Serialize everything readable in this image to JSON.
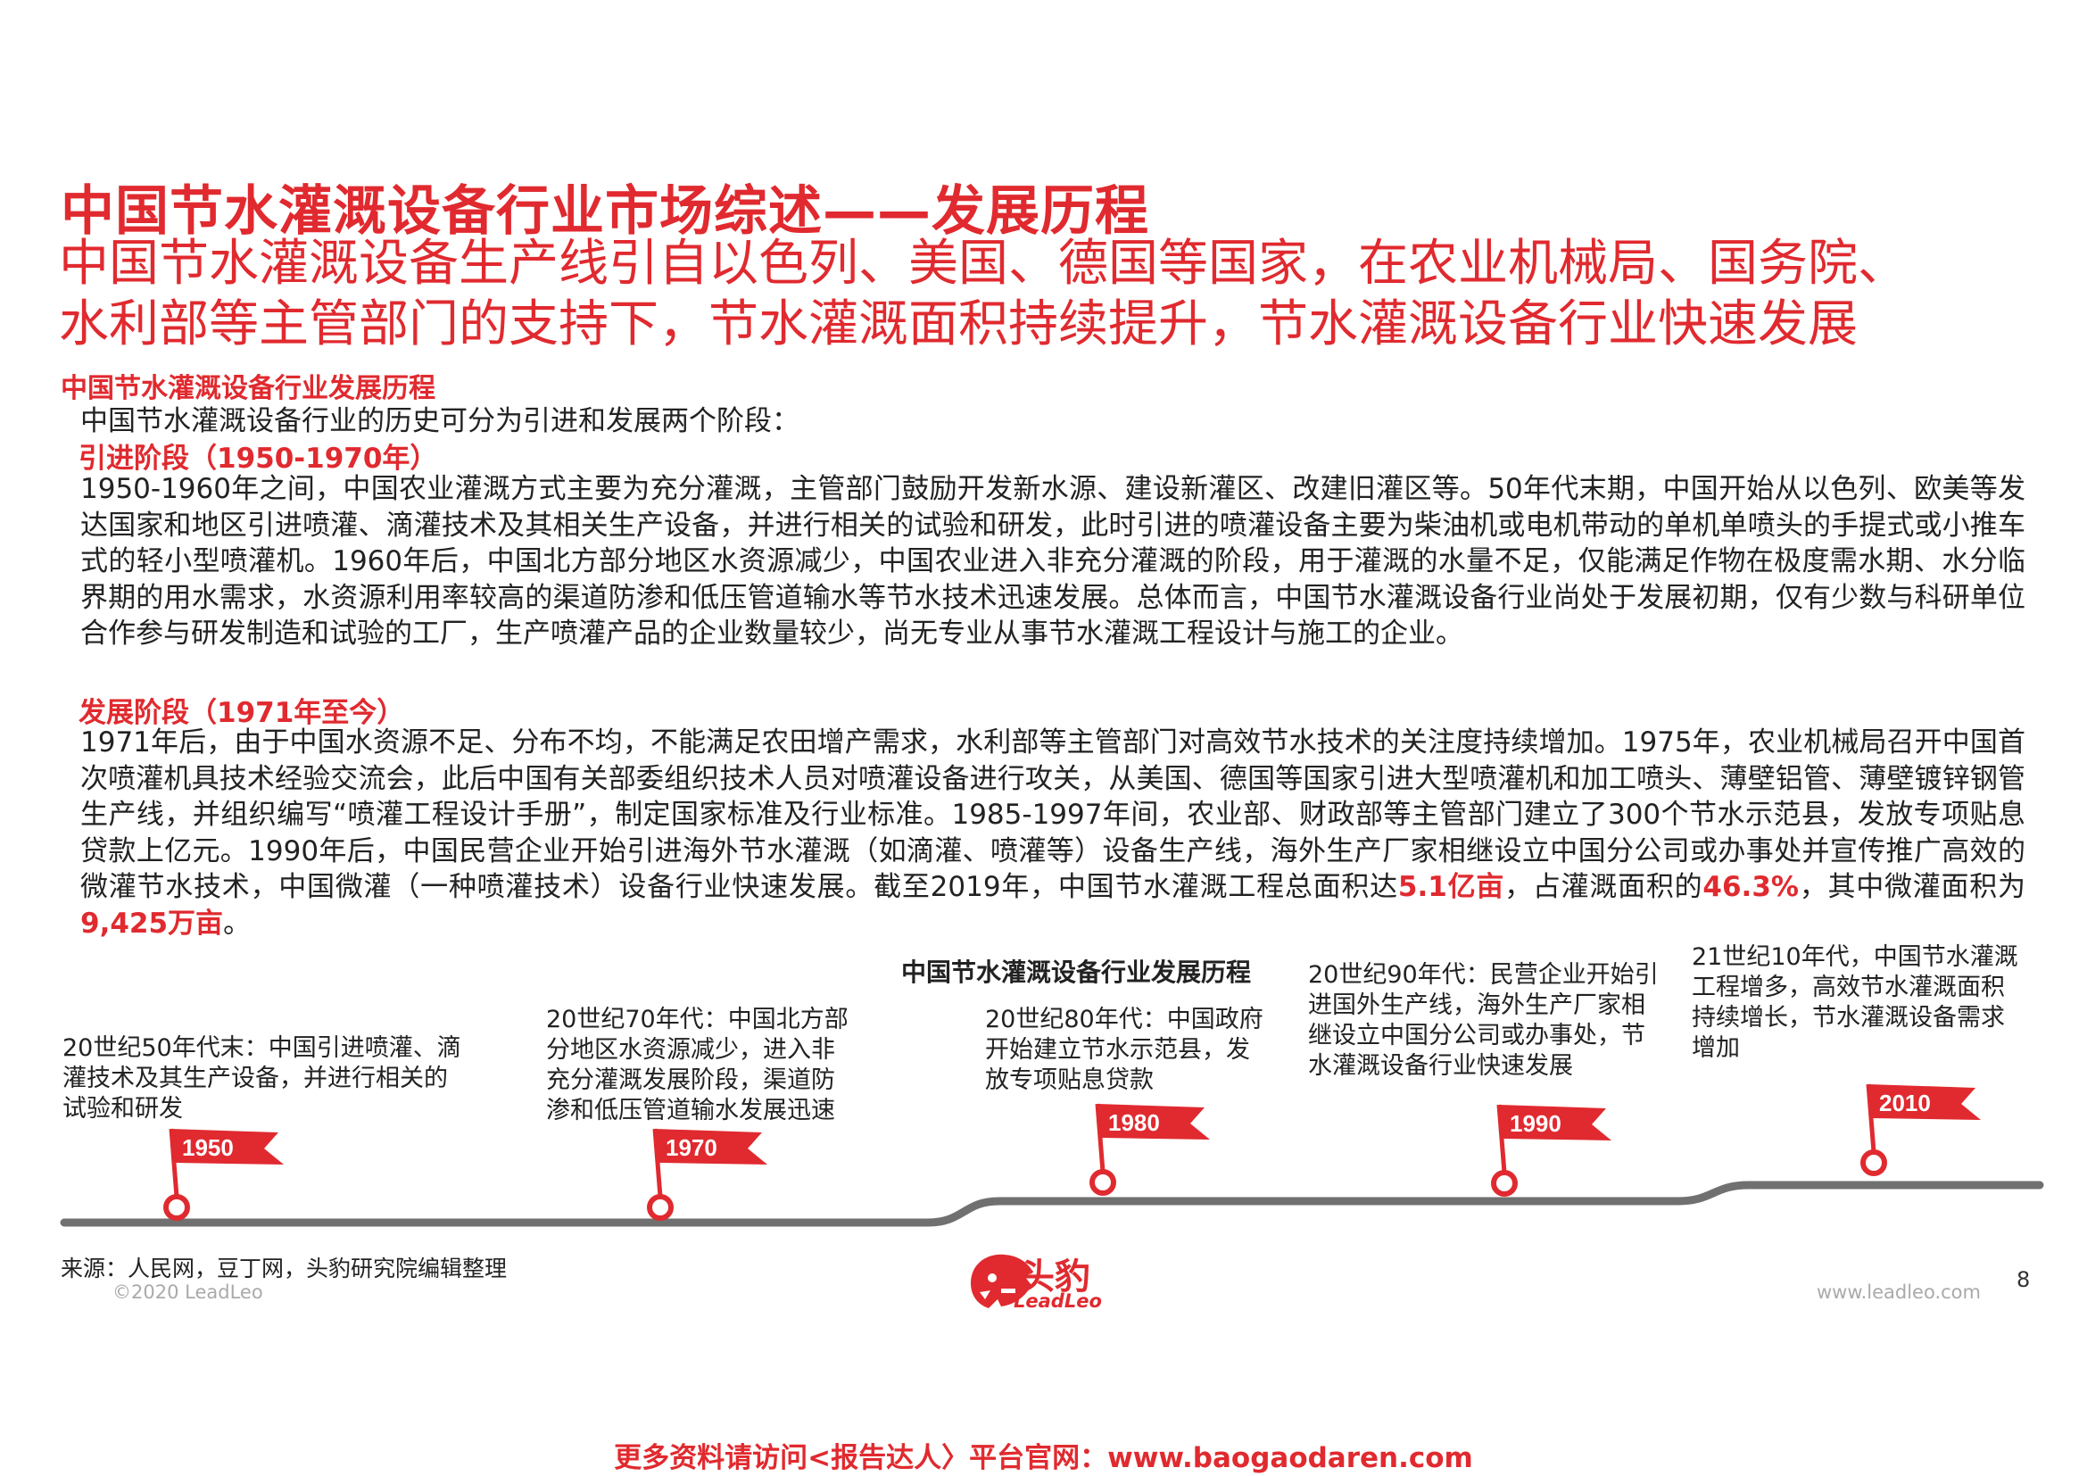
{
  "header": {
    "title": "中国节水灌溉设备行业市场综述——发展历程",
    "subtitle_line1": "中国节水灌溉设备生产线引自以色列、美国、德国等国家，在农业机械局、国务院、",
    "subtitle_line2": "水利部等主管部门的支持下，节水灌溉面积持续提升，节水灌溉设备行业快速发展"
  },
  "body": {
    "section_heading": "中国节水灌溉设备行业发展历程",
    "intro": "中国节水灌溉设备行业的历史可分为引进和发展两个阶段：",
    "stage1_heading": "引进阶段（1950-1970年）",
    "stage1_text": "1950-1960年之间，中国农业灌溉方式主要为充分灌溉，主管部门鼓励开发新水源、建设新灌区、改建旧灌区等。50年代末期，中国开始从以色列、欧美等发达国家和地区引进喷灌、滴灌技术及其相关生产设备，并进行相关的试验和研发，此时引进的喷灌设备主要为柴油机或电机带动的单机单喷头的手提式或小推车式的轻小型喷灌机。1960年后，中国北方部分地区水资源减少，中国农业进入非充分灌溉的阶段，用于灌溉的水量不足，仅能满足作物在极度需水期、水分临界期的用水需求，水资源利用率较高的渠道防渗和低压管道输水等节水技术迅速发展。总体而言，中国节水灌溉设备行业尚处于发展初期，仅有少数与科研单位合作参与研发制造和试验的工厂，生产喷灌产品的企业数量较少，尚无专业从事节水灌溉工程设计与施工的企业。",
    "stage2_heading": "发展阶段（1971年至今）",
    "stage2_text": "1971年后，由于中国水资源不足、分布不均，不能满足农田增产需求，水利部等主管部门对高效节水技术的关注度持续增加。1975年，农业机械局召开中国首次喷灌机具技术经验交流会，此后中国有关部委组织技术人员对喷灌设备进行攻关，从美国、德国等国家引进大型喷灌机和加工喷头、薄壁铝管、薄壁镀锌钢管生产线，并组织编写“喷灌工程设计手册”，制定国家标准及行业标准。1985-1997年间，农业部、财政部等主管部门建立了300个节水示范县，发放专项贴息贷款上亿元。1990年后，中国民营企业开始引进海外节水灌溉（如滴灌、喷灌等）设备生产线，海外生产厂家相继设立中国分公司或办事处并宣传推广高效的微灌节水技术，中国微灌（一种喷灌技术）设备行业快速发展。截至2019年，中国节水灌溉工程总面积达",
    "stage2_hl1": "5.1亿亩",
    "stage2_mid1": "，占灌溉面积的",
    "stage2_hl2": "46.3%",
    "stage2_mid2": "，其中微灌面积为",
    "stage2_hl3": "9,425万亩",
    "stage2_end": "。"
  },
  "timeline": {
    "title": "中国节水灌溉设备行业发展历程",
    "events": [
      {
        "year": "1950",
        "text_lines": [
          "20世纪50年代末：中国引进喷灌、滴",
          "灌技术及其生产设备，并进行相关的",
          "试验和研发"
        ]
      },
      {
        "year": "1970",
        "text_lines": [
          "20世纪70年代：中国北方部",
          "分地区水资源减少，进入非",
          "充分灌溉发展阶段，渠道防",
          "渗和低压管道输水发展迅速"
        ]
      },
      {
        "year": "1980",
        "text_lines": [
          "20世纪80年代：中国政府",
          "开始建立节水示范县，发",
          "放专项贴息贷款"
        ]
      },
      {
        "year": "1990",
        "text_lines": [
          "20世纪90年代：民营企业开始引",
          "进国外生产线，海外生产厂家相",
          "继设立中国分公司或办事处，节",
          "水灌溉设备行业快速发展"
        ]
      },
      {
        "year": "2010",
        "text_lines": [
          "21世纪10年代，中国节水灌溉",
          "工程增多，高效节水灌溉面积",
          "持续增长，节水灌溉设备需求",
          "增加"
        ]
      }
    ]
  },
  "footer": {
    "source": "来源：人民网，豆丁网，头豹研究院编辑整理",
    "copyright": "©2020 LeadLeo",
    "brand_cn": "头豹",
    "brand_en": "LeadLeo",
    "website": "www.leadleo.com",
    "page_number": "8",
    "more_link": "更多资料请访问<报告达人〉平台官网：www.baogaodaren.com"
  },
  "colors": {
    "accent": "#e02a2f",
    "road": "#707070",
    "text": "#222222"
  }
}
